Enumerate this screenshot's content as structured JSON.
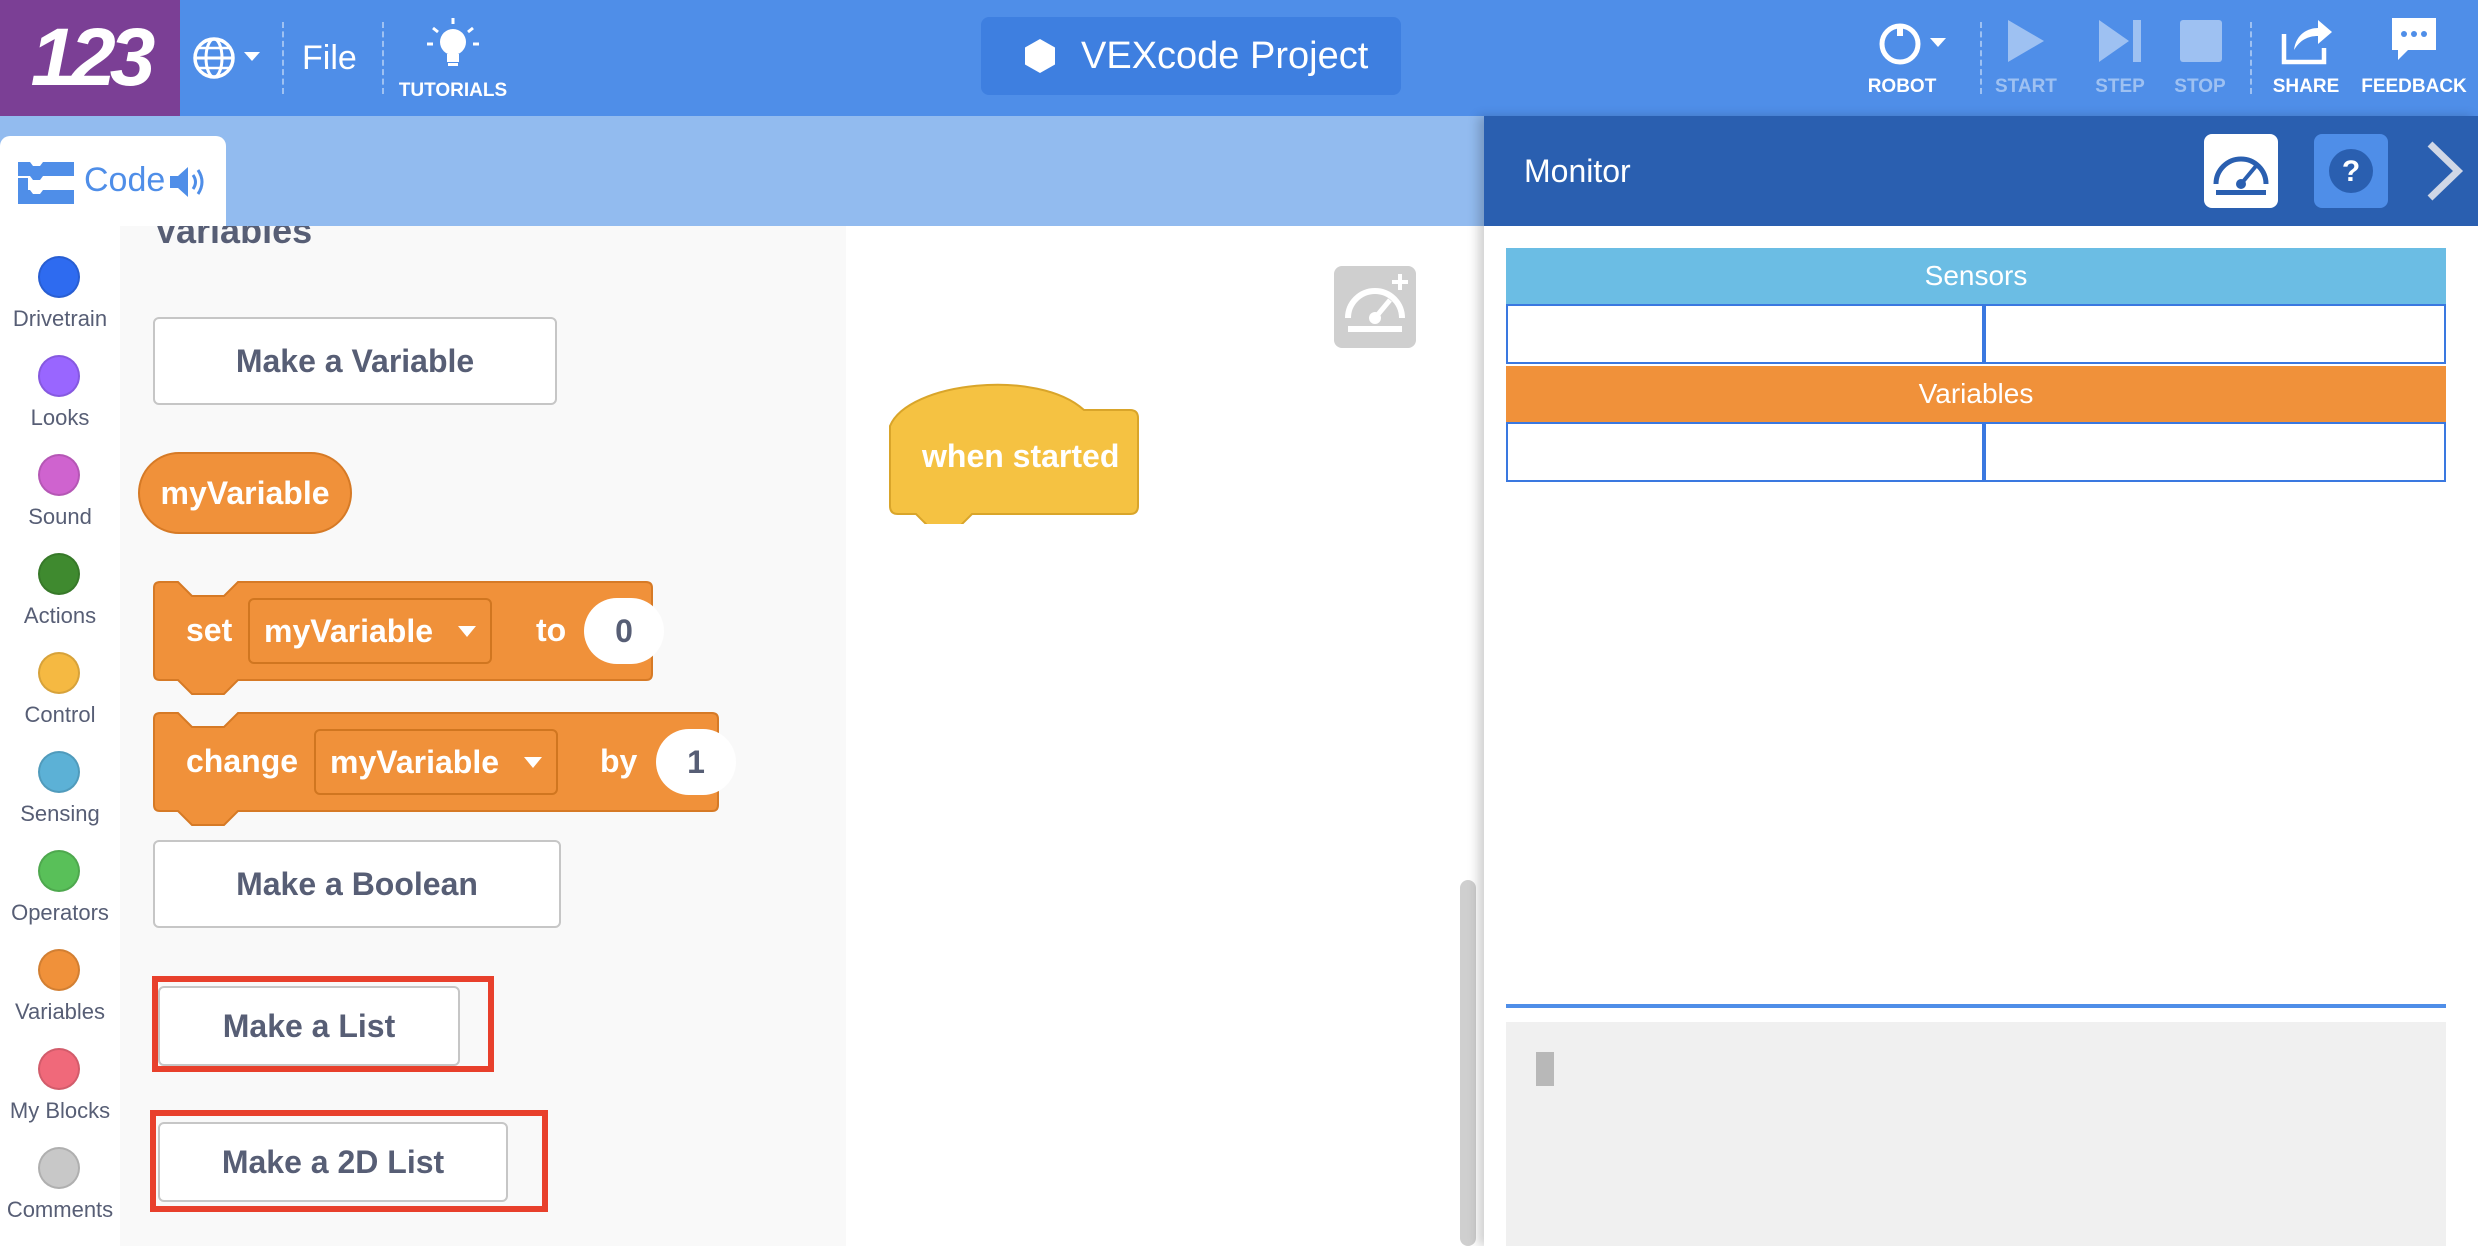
{
  "app": {
    "logo_text": "123",
    "file_label": "File",
    "tutorials_label": "TUTORIALS",
    "project_title": "VEXcode Project"
  },
  "toolbar": {
    "robot_label": "ROBOT",
    "start_label": "START",
    "step_label": "STEP",
    "stop_label": "STOP",
    "share_label": "SHARE",
    "feedback_label": "FEEDBACK"
  },
  "code_tab": {
    "label": "Code"
  },
  "categories": [
    {
      "name": "Drivetrain",
      "color": "#2e6bf0"
    },
    {
      "name": "Looks",
      "color": "#9966ff"
    },
    {
      "name": "Sound",
      "color": "#cf63cf"
    },
    {
      "name": "Actions",
      "color": "#3f8a2f"
    },
    {
      "name": "Control",
      "color": "#f5b942"
    },
    {
      "name": "Sensing",
      "color": "#5cb1d6"
    },
    {
      "name": "Operators",
      "color": "#59c059"
    },
    {
      "name": "Variables",
      "color": "#f0913a"
    },
    {
      "name": "My Blocks",
      "color": "#f0697a"
    },
    {
      "name": "Comments",
      "color": "#c8c8c8"
    }
  ],
  "flyout": {
    "heading": "Variables",
    "make_variable": "Make a Variable",
    "variable_reporter": "myVariable",
    "set_block": {
      "keyword": "set",
      "variable": "myVariable",
      "to_word": "to",
      "value": "0"
    },
    "change_block": {
      "keyword": "change",
      "variable": "myVariable",
      "by_word": "by",
      "value": "1"
    },
    "make_boolean": "Make a Boolean",
    "make_list": "Make a List",
    "make_2d_list": "Make a 2D List"
  },
  "workspace": {
    "hat_block": "when started"
  },
  "monitor": {
    "title": "Monitor",
    "sensors_label": "Sensors",
    "variables_label": "Variables",
    "sensors_color": "#6bbde4",
    "variables_color": "#f0913a"
  },
  "colors": {
    "topbar": "#4f8ee8",
    "logo": "#7b3f95",
    "highlight": "#e8402c",
    "variable_block": "#f0913a",
    "hat_block": "#f5c242"
  }
}
